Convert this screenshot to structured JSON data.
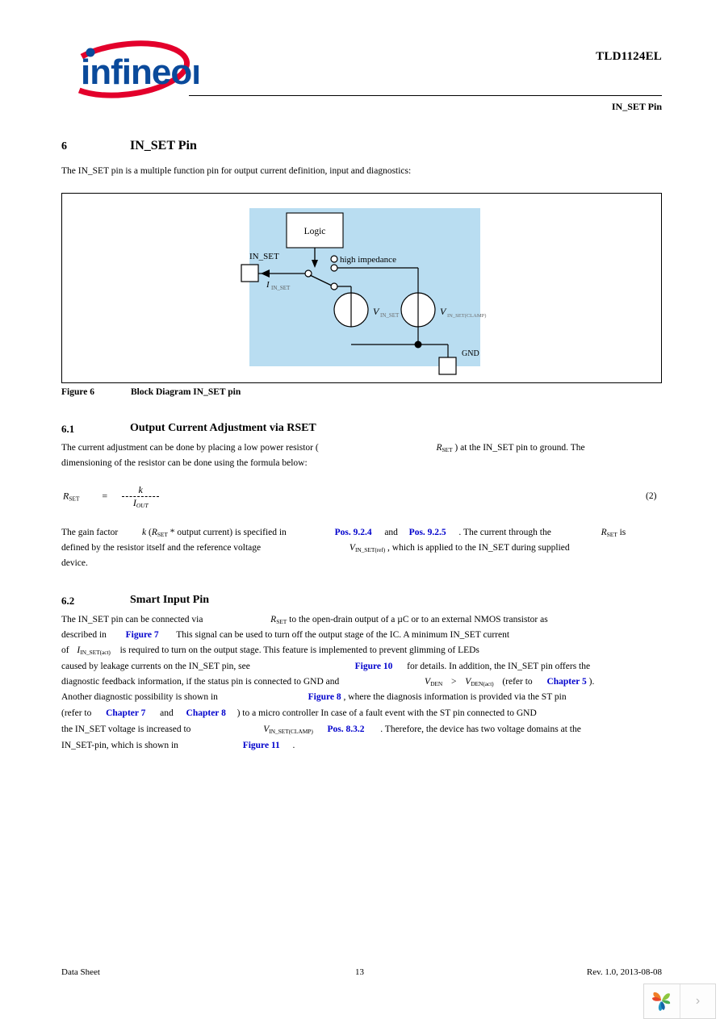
{
  "header": {
    "doc_title": "TLD1124EL",
    "running_head": "IN_SET Pin",
    "logo_name": "infineon"
  },
  "section6": {
    "number": "6",
    "title": "IN_SET Pin",
    "intro": "The IN_SET pin is a multiple function pin for output current definition, input and diagnostics:"
  },
  "figure": {
    "caption_label": "Figure 6",
    "caption_text": "Block Diagram IN_SET pin",
    "background_color": "#b9ddf1",
    "labels": {
      "logic": "Logic",
      "pin": "IN_SET",
      "current": "I",
      "current_sub": "IN_SET",
      "high_impedance": "high impedance",
      "v1": "V",
      "v1_sub": "IN_SET",
      "v2": "V",
      "v2_sub": "IN_SET(CLAMP)",
      "gnd": "GND"
    }
  },
  "section61": {
    "number": "6.1",
    "title": "Output Current Adjustment via RSET",
    "line1_a": "The current adjustment can be done by placing a low power resistor (",
    "line1_var": "R",
    "line1_var_sub": "SET",
    "line1_b": ") at the IN_SET pin to ground. The",
    "line2": "dimensioning of the resistor can be done using the formula below:",
    "equation": {
      "lhs": "R",
      "lhs_sub": "SET",
      "eq": "=",
      "numerator": "k",
      "denominator": "I",
      "denominator_sub": "OUT",
      "number": "(2)"
    },
    "p2_l1_a": "The gain factor",
    "p2_l1_k": "k",
    "p2_l1_b": "(",
    "p2_l1_var": "R",
    "p2_l1_var_sub": "SET",
    "p2_l1_c": "* output current) is specified in",
    "p2_link1": "Pos. 9.2.4",
    "p2_and": "and",
    "p2_link2": "Pos. 9.2.5",
    "p2_l1_d": ". The current through the",
    "p2_l1_var2": "R",
    "p2_l1_var2_sub": "SET",
    "p2_l1_e": "is",
    "p2_l2_a": "defined by the resistor itself and the reference voltage",
    "p2_l2_var": "V",
    "p2_l2_var_sub": "IN_SET(ref)",
    "p2_l2_b": ", which is applied to the IN_SET during supplied",
    "p2_l3": "device."
  },
  "section62": {
    "number": "6.2",
    "title": "Smart Input Pin",
    "l1_a": "The IN_SET pin can be connected via",
    "l1_var": "R",
    "l1_var_sub": "SET",
    "l1_b": "to the open-drain output of a µC or to an external NMOS transistor as",
    "l2_a": "described in",
    "l2_link": "Figure 7",
    "l2_b": "This signal can be used to turn off the output stage of the IC. A minimum IN_SET current",
    "l3_a": "of",
    "l3_var": "I",
    "l3_var_sub": "IN_SET(act)",
    "l3_b": "is required to turn on the output stage. This feature is implemented to prevent glimming of LEDs",
    "l4_a": "caused by leakage currents on the IN_SET pin, see",
    "l4_link": "Figure 10",
    "l4_b": "for details. In addition, the IN_SET pin offers the",
    "l5_a": "diagnostic feedback information, if the status pin is connected to GND and",
    "l5_var1": "V",
    "l5_var1_sub": "DEN",
    "l5_gt": ">",
    "l5_var2": "V",
    "l5_var2_sub": "DEN(act)",
    "l5_b": "(refer to",
    "l5_link": "Chapter 5",
    "l5_c": ").",
    "l6_a": "Another diagnostic possibility is shown in",
    "l6_link": "Figure 8",
    "l6_b": ", where the diagnosis information is provided via the ST pin",
    "l7_a": "(refer to",
    "l7_link1": "Chapter 7",
    "l7_and": "and",
    "l7_link2": "Chapter 8",
    "l7_b": ") to a micro controller In case of a fault event with the ST pin connected to GND",
    "l8_a": "the IN_SET voltage is increased to",
    "l8_var": "V",
    "l8_var_sub": "IN_SET(CLAMP)",
    "l8_link": "Pos. 8.3.2",
    "l8_b": ". Therefore, the device has two voltage domains at the",
    "l9_a": "IN_SET-pin, which is shown in",
    "l9_link": "Figure 11",
    "l9_b": "."
  },
  "footer": {
    "left": "Data Sheet",
    "page_number": "13",
    "right": "Rev. 1.0, 2013-08-08"
  },
  "nav_widget": {
    "next_glyph": "›"
  },
  "colors": {
    "link_blue": "#0000CC",
    "logo_red": "#E3002B",
    "logo_blue": "#0A4A9B",
    "diagram_blue": "#b9ddf1"
  }
}
